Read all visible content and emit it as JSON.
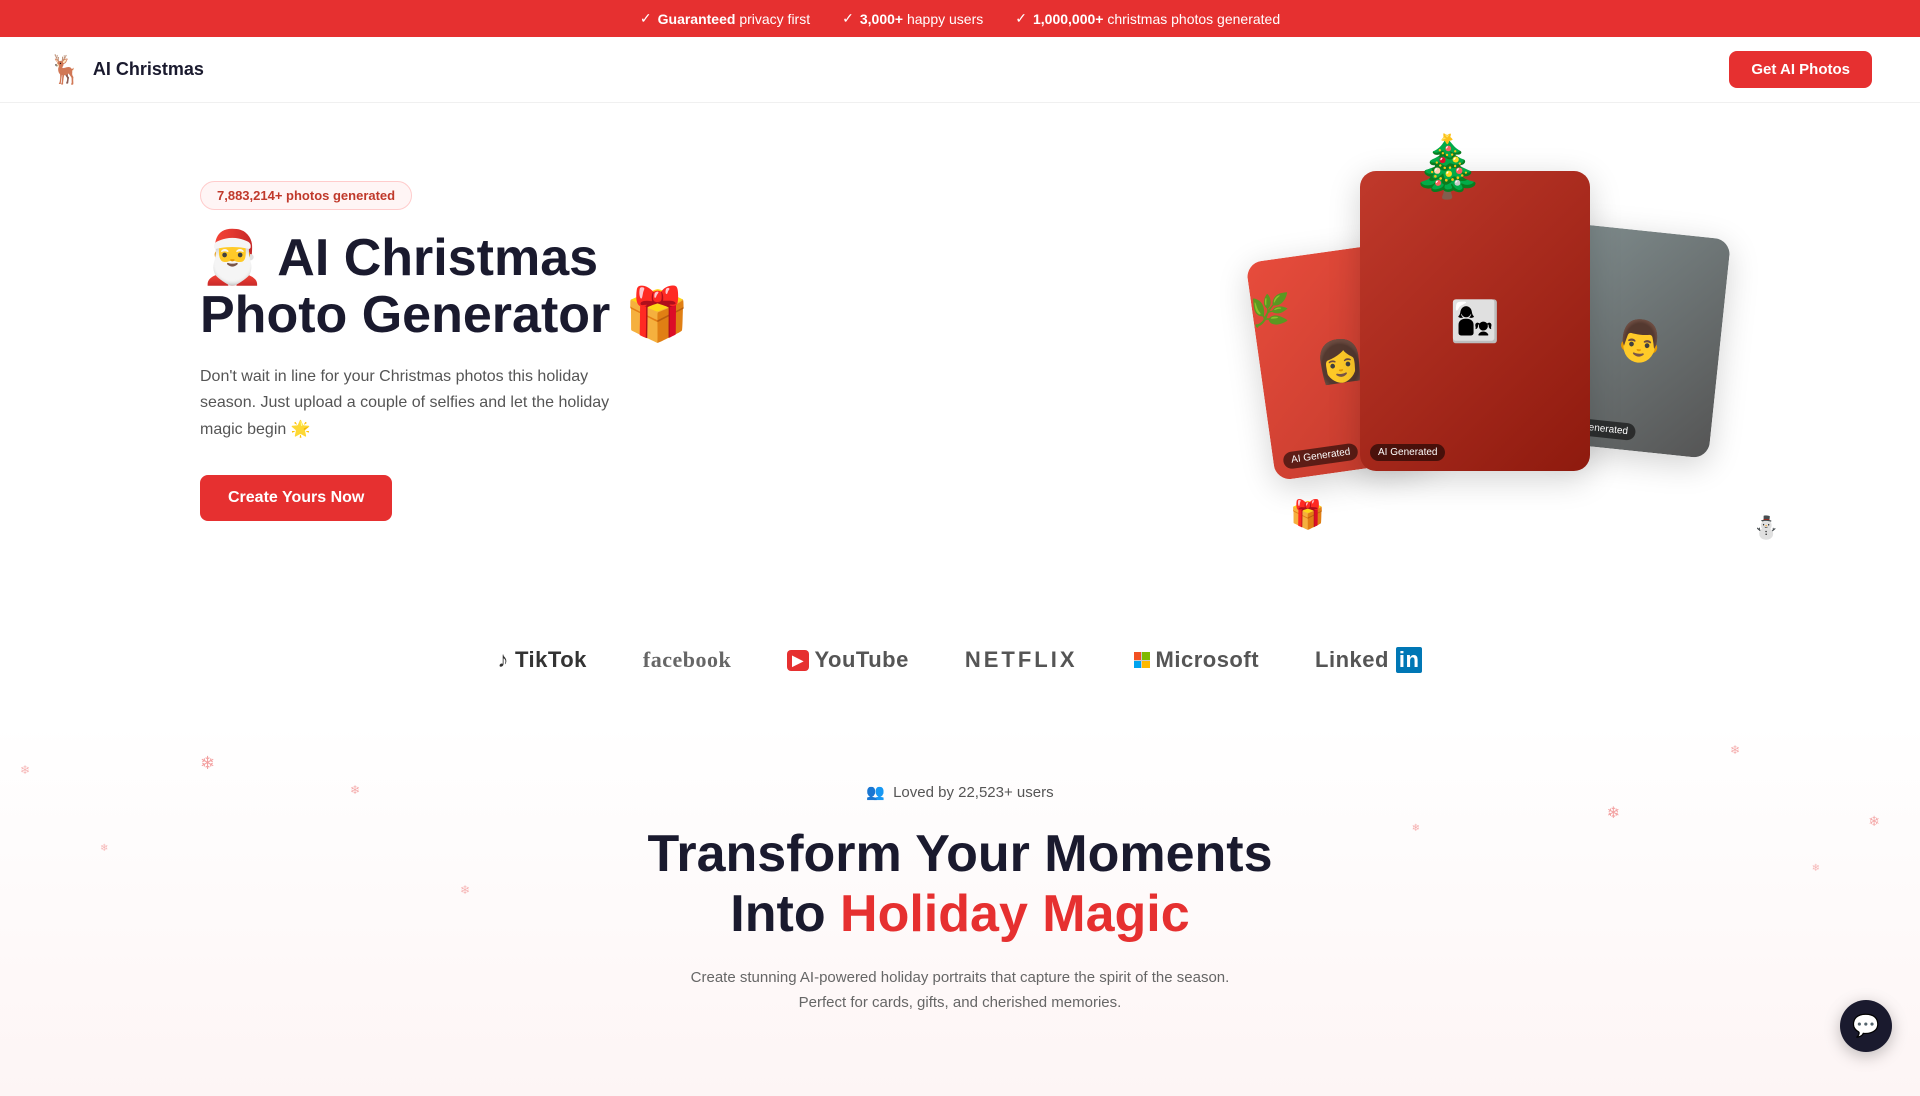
{
  "banner": {
    "items": [
      {
        "icon": "✓",
        "text": "Guaranteed privacy first"
      },
      {
        "icon": "✓",
        "prefix": "3,000+",
        "text": " happy users"
      },
      {
        "icon": "✓",
        "prefix": "1,000,000+",
        "text": " christmas photos generated"
      }
    ]
  },
  "nav": {
    "logo_icon": "🦌",
    "logo_text": "AI Christmas",
    "cta_label": "Get AI Photos"
  },
  "hero": {
    "badge": "7,883,214+ photos generated",
    "title_emoji": "🎅",
    "title_line1": "AI Christmas",
    "title_line2": "Photo Generator",
    "title_gift": "🎁",
    "description": "Don't wait in line for your Christmas photos this holiday season. Just upload a couple of selfies and let the holiday magic begin 🌟",
    "cta_label": "Create Yours Now"
  },
  "photo_cards": {
    "ai_badge": "AI Generated",
    "photo_main_emoji": "👩‍👧",
    "photo_left_emoji": "👩",
    "photo_right_emoji": "👨"
  },
  "brands": {
    "items": [
      {
        "name": "TikTok",
        "icon": "♪",
        "class": "tiktok"
      },
      {
        "name": "facebook",
        "icon": "",
        "class": "facebook"
      },
      {
        "name": "YouTube",
        "icon": "▶",
        "class": "youtube"
      },
      {
        "name": "NETFLIX",
        "icon": "",
        "class": "netflix"
      },
      {
        "name": "Microsoft",
        "icon": "⊞",
        "class": "microsoft"
      },
      {
        "name": "LinkedIn",
        "icon": "",
        "class": "linkedin"
      }
    ]
  },
  "lower": {
    "loved_icon": "👥",
    "loved_text": "Loved by 22,523+ users",
    "title_line1": "Transform Your Moments",
    "title_line2_plain": "Into ",
    "title_line2_highlight": "Holiday Magic",
    "description": "Create stunning AI-powered holiday portraits that capture the spirit of the season. Perfect for cards, gifts, and cherished memories."
  },
  "chat_btn": {
    "icon": "💬"
  }
}
